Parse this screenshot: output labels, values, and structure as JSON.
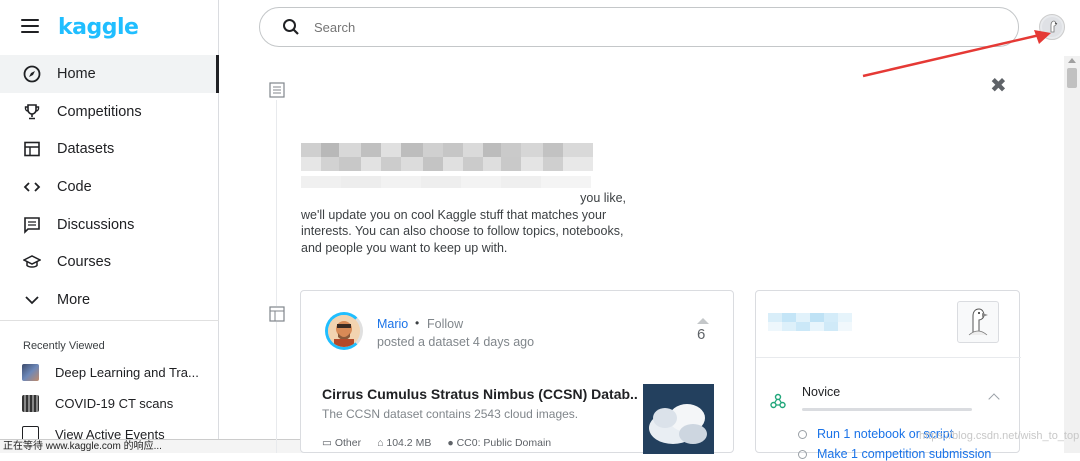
{
  "brand": {
    "logo_text": "kaggle",
    "accent": "#20beff"
  },
  "nav": {
    "items": [
      {
        "label": "Home",
        "icon": "compass-icon",
        "active": true
      },
      {
        "label": "Competitions",
        "icon": "trophy-icon"
      },
      {
        "label": "Datasets",
        "icon": "table-icon"
      },
      {
        "label": "Code",
        "icon": "code-icon"
      },
      {
        "label": "Discussions",
        "icon": "comment-icon"
      },
      {
        "label": "Courses",
        "icon": "school-icon"
      },
      {
        "label": "More",
        "icon": "chevron-down-icon"
      }
    ]
  },
  "recently_viewed": {
    "title": "Recently Viewed",
    "items": [
      {
        "label": "Deep Learning and Tra..."
      },
      {
        "label": "COVID-19 CT scans"
      },
      {
        "label": "View Active Events"
      }
    ]
  },
  "status_bar": {
    "text": "正在等待 www.kaggle.com 的响应..."
  },
  "search": {
    "placeholder": "Search"
  },
  "intro": {
    "line1_tail": "you like,",
    "text": "we'll update you on cool Kaggle stuff that matches your interests. You can also choose to follow topics, notebooks, and people you want to keep up with."
  },
  "feed_card": {
    "author": "Mario",
    "follow_label": "Follow",
    "posted": "posted a dataset 4 days ago",
    "votes": "6",
    "title": "Cirrus Cumulus Stratus Nimbus (CCSN) Datab...",
    "description": "The CCSN dataset contains 2543 cloud images.",
    "meta": {
      "type": "Other",
      "size": "104.2 MB",
      "license": "CC0: Public Domain"
    }
  },
  "side_card": {
    "level": "Novice",
    "tasks": [
      {
        "label": "Run 1 notebook or script"
      },
      {
        "label": "Make 1 competition submission"
      }
    ]
  },
  "watermark": "https://blog.csdn.net/wish_to_top"
}
